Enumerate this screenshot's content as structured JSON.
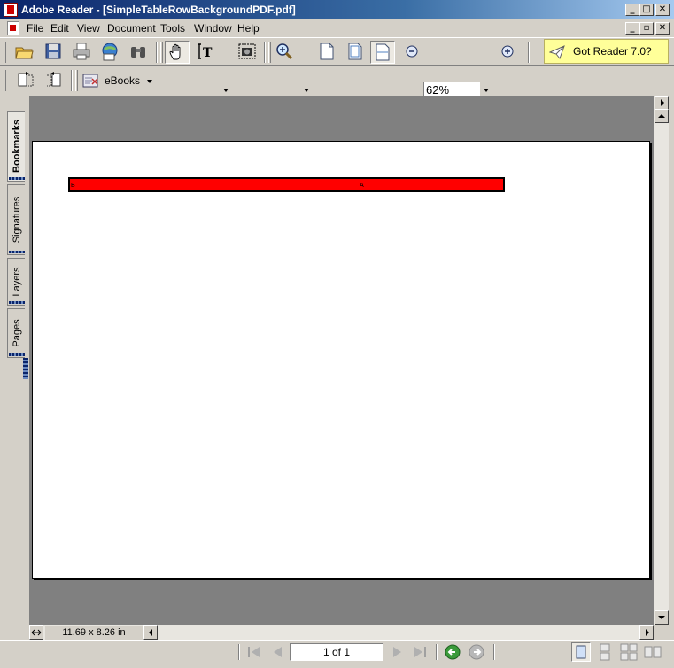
{
  "window": {
    "title": "Adobe Reader - [SimpleTableRowBackgroundPDF.pdf]",
    "minimize": "_",
    "maximize": "□",
    "close": "✕",
    "restore": "▫"
  },
  "menu": {
    "items": [
      "File",
      "Edit",
      "View",
      "Document",
      "Tools",
      "Window",
      "Help"
    ]
  },
  "toolbar": {
    "zoom_value": "62%",
    "promo_label": "Got Reader 7.0?",
    "ebooks_label": "eBooks"
  },
  "nav_tabs": [
    {
      "label": "Bookmarks",
      "active": true
    },
    {
      "label": "Signatures",
      "active": false
    },
    {
      "label": "Layers",
      "active": false
    },
    {
      "label": "Pages",
      "active": false
    }
  ],
  "document": {
    "row_color": "#ff0000",
    "cell_texts": [
      "B",
      "A"
    ]
  },
  "status": {
    "page_size": "11.69 x 8.26 in",
    "page_indicator": "1 of 1"
  }
}
